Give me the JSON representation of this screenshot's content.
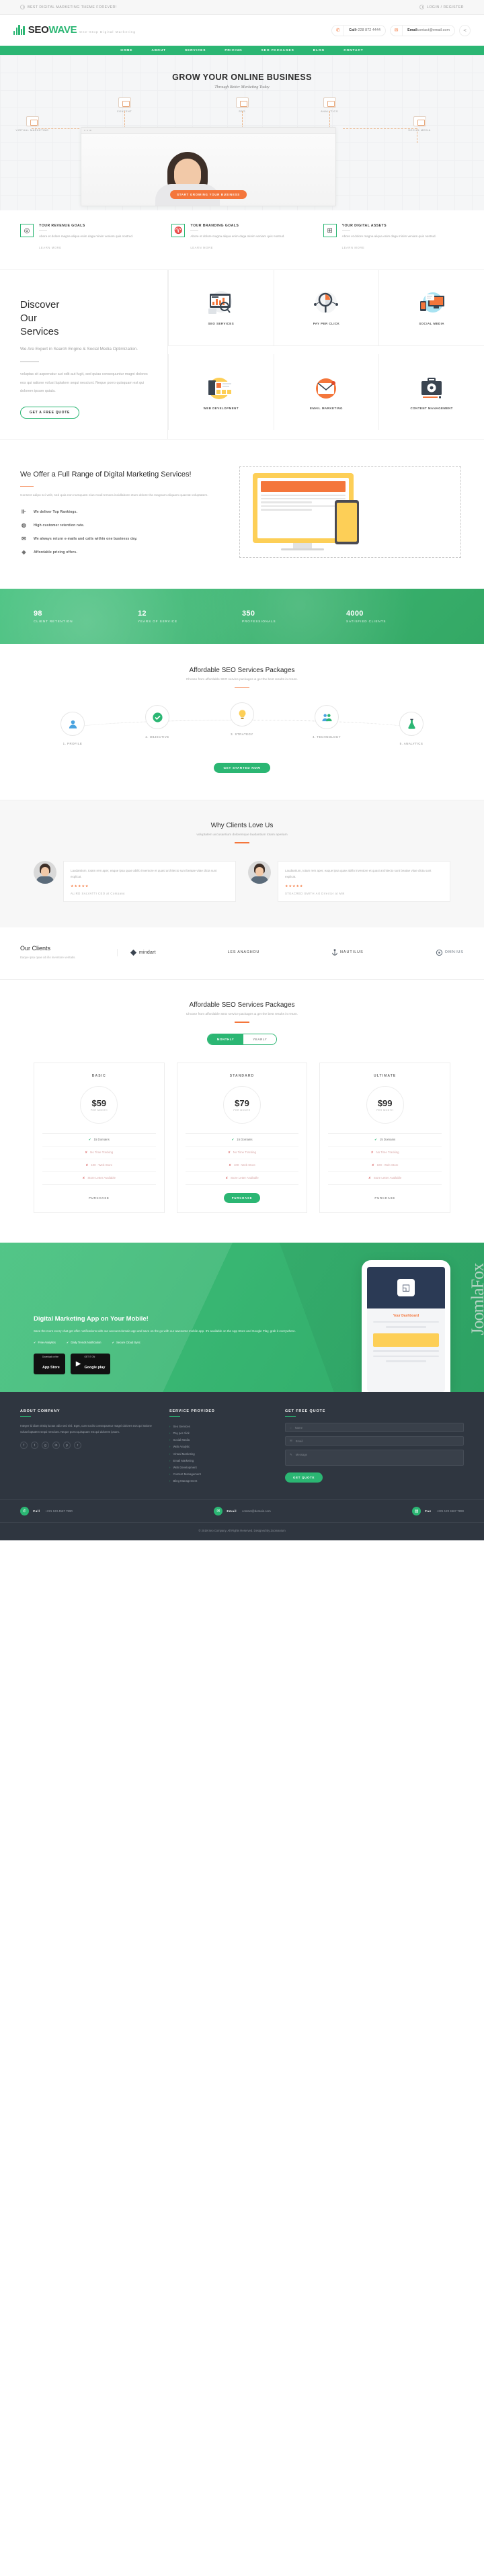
{
  "topbar": {
    "left": "BEST DIGITAL MARKETING THEME FOREVER!",
    "right": "LOGIN / REGISTER",
    "left_icon": "clock-icon",
    "right_icon": "user-icon"
  },
  "header": {
    "brand_a": "SEO",
    "brand_b": "WAVE",
    "tagline": "One-Stop Digital Marketing",
    "phone_label": "Call",
    "phone_value": "+228 872 4444",
    "email_label": "Email",
    "email_value": "contact@email.com",
    "share_icon": "share-icon"
  },
  "nav": {
    "items": [
      {
        "label": "HOME"
      },
      {
        "label": "ABOUT"
      },
      {
        "label": "SERVICES"
      },
      {
        "label": "PRICING"
      },
      {
        "label": "SEO PACKAGES"
      },
      {
        "label": "BLOG"
      },
      {
        "label": "CONTACT"
      }
    ]
  },
  "hero": {
    "title": "GROW YOUR ONLINE BUSINESS",
    "subtitle": "Through Better Marketing Today",
    "cta": "START GROWING YOUR BUSINESS",
    "nodes": [
      {
        "label": "VIRTUAL MARKETING"
      },
      {
        "label": "CONTENT"
      },
      {
        "label": "SEO"
      },
      {
        "label": "ANALYTICS"
      },
      {
        "label": "SOCIAL MEDIA"
      }
    ]
  },
  "features": [
    {
      "icon": "target-icon",
      "title": "YOUR REVENUE GOALS",
      "text": "Abore et dolore magna aliqua enim daga minim veniam quis nostrud.",
      "link": "LEARN MORE"
    },
    {
      "icon": "bulb-icon",
      "title": "YOUR BRANDING GOALS",
      "text": "Abore et dolore magna aliqua enim daga minim veniam quis nostrud.",
      "link": "LEARN MORE"
    },
    {
      "icon": "chart-icon",
      "title": "YOUR DIGITAL ASSETS",
      "text": "Abore et dolore magna aliqua enim daga minim veniam quis nostrud.",
      "link": "LEARN MORE"
    }
  ],
  "services": {
    "heading_line1": "Discover",
    "heading_line2": "Our",
    "heading_line3": "Services",
    "lead": "We Are Expert in Search Engine & Social Media Optimization.",
    "body": "voluptas sit aspernatur aut odit aut fugit, sed quias consequuntur magni dolores eos qui ratione volust luptatem sequi nesciunt. Neque porro quisquam est qui dolorem ipsum quiala.",
    "button": "GET A FREE QUOTE",
    "items": [
      {
        "label": "SEO SERVICES",
        "icon": "seo-dashboard-icon"
      },
      {
        "label": "PAY PER CLICK",
        "icon": "magnifier-pie-icon"
      },
      {
        "label": "SOCIAL MEDIA",
        "icon": "monitor-chat-icon"
      },
      {
        "label": "WEB DEVELOPMENT",
        "icon": "browser-layout-icon"
      },
      {
        "label": "EMAIL MARKETING",
        "icon": "envelope-icon"
      },
      {
        "label": "CONTENT MANAGEMENT",
        "icon": "briefcase-gear-icon"
      }
    ]
  },
  "range": {
    "title": "We Offer a Full Range of Digital Marketing Services!",
    "text": "Consect adipo sci velit, sed quia non numquam eius modi temora incidlabore etum dolore tha magnam aliquam quaerat voluptatem.",
    "points": [
      {
        "icon": "bar-chart-icon",
        "label": "We deliver Top Rankings."
      },
      {
        "icon": "people-icon",
        "label": "High customer retention rate."
      },
      {
        "icon": "mail-icon",
        "label": "We always return e-mails and calls within one business day."
      },
      {
        "icon": "tag-icon",
        "label": "Affordable pricing offers."
      }
    ]
  },
  "counters": [
    {
      "num": "98",
      "label": "CLIENT RETENTION"
    },
    {
      "num": "12",
      "label": "YEARS OF SERVICE"
    },
    {
      "num": "350",
      "label": "PROFESSIONALS"
    },
    {
      "num": "4000",
      "label": "SATISFIED CLIENTS"
    }
  ],
  "packages_steps": {
    "title": "Affordable SEO Services Packages",
    "subtitle": "Choose from affordable SEO service packages & get the best results in return.",
    "steps": [
      {
        "num": "1",
        "label": "1. PROFILE",
        "icon": "user-circle-icon"
      },
      {
        "num": "2",
        "label": "2. OBJECTIVE",
        "icon": "check-target-icon"
      },
      {
        "num": "3",
        "label": "3. STRATEGY",
        "icon": "bulb-idea-icon"
      },
      {
        "num": "4",
        "label": "4. TECHNOLOGY",
        "icon": "group-icon"
      },
      {
        "num": "5",
        "label": "5. ANALYTICS",
        "icon": "flask-icon"
      }
    ],
    "button": "GET STARTED NOW"
  },
  "testimonials": {
    "title": "Why Clients Love Us",
    "subtitle": "voluptatem accusantium doloremque laudantium totam aperiam",
    "items": [
      {
        "text": "Laudantium, totam rem aper, eaque ipsa quae abillo inventore et quasi architecto sunt beatae vitae dicta sunt explicat.",
        "stars": "★★★★★",
        "name": "ALIRD SALVATTI",
        "role": "CEO at Company"
      },
      {
        "text": "Laudantium, totam rem aper, eaque ipsa quae abillo inventore et quasi architecto sunt beatae vitae dicta sunt explicat.",
        "stars": "★★★★★",
        "name": "STEACRED SMITH",
        "role": "Art Director at Mik"
      }
    ]
  },
  "clients": {
    "title": "Our Clients",
    "text": "Eaque ipsa quae ab illo inventore veritatis.",
    "logos": [
      {
        "name": "mindart",
        "sub": ""
      },
      {
        "name": "LES ANAGHOU",
        "sub": ""
      },
      {
        "name": "NAUTILUS",
        "sub": ""
      },
      {
        "name": "OMNIUS",
        "sub": ""
      }
    ]
  },
  "pricing": {
    "title": "Affordable SEO Services Packages",
    "subtitle": "Choose from affordable SEO service packages & get the best results in return.",
    "toggle_on": "MONTHLY",
    "toggle_off": "YEARLY",
    "plans": [
      {
        "name": "BASIC",
        "price": "$59",
        "per": "PER MONTH",
        "features": [
          {
            "label": "15 Domains",
            "ok": true
          },
          {
            "label": "No Time Tracking",
            "ok": false
          },
          {
            "label": "100 - Web Store",
            "ok": false
          },
          {
            "label": "Store Letter Available",
            "ok": false
          }
        ],
        "button": "PURCHASE",
        "featured": false
      },
      {
        "name": "STANDARD",
        "price": "$79",
        "per": "PER MONTH",
        "features": [
          {
            "label": "15 Domains",
            "ok": true
          },
          {
            "label": "No Time Tracking",
            "ok": false
          },
          {
            "label": "100 - Web Store",
            "ok": false
          },
          {
            "label": "Store Letter Available",
            "ok": false
          }
        ],
        "button": "PURCHASE",
        "featured": true
      },
      {
        "name": "ULTIMATE",
        "price": "$99",
        "per": "PER MONTH",
        "features": [
          {
            "label": "15 Domains",
            "ok": true
          },
          {
            "label": "No Time Tracking",
            "ok": false
          },
          {
            "label": "100 - Web Store",
            "ok": false
          },
          {
            "label": "Store Letter Available",
            "ok": false
          }
        ],
        "button": "PURCHASE",
        "featured": false
      }
    ]
  },
  "app": {
    "title": "Digital Marketing App on Your Mobile!",
    "text": "Save the more every chat get offer notifications with our account domain app and save on the go with our awesome mobile app. It's available on the App Store and Google Play, grab it everywhere.",
    "points": [
      {
        "label": "Free Analytics",
        "icon": "check-icon"
      },
      {
        "label": "Daily Trends Notification",
        "icon": "check-icon"
      },
      {
        "label": "Secure Cloud Sync",
        "icon": "check-icon"
      }
    ],
    "store1_small": "Download on the",
    "store1_big": "App Store",
    "store2_small": "GET IT ON",
    "store2_big": "Google play",
    "phone_title": "Your Dashboard"
  },
  "footer": {
    "about": {
      "title": "ABOUT COMPANY",
      "text": "Integer id diam tristiq luctus odio sed nisl. Eget, cum sociis consequuntur magni dolores eos qui ratione volust luptatem sequi nesciunt. Neque porro quisquam est qui dolorem ipsum."
    },
    "social_icons": [
      "facebook-icon",
      "twitter-icon",
      "google-plus-icon",
      "linkedin-icon",
      "pinterest-icon",
      "rss-icon"
    ],
    "links": {
      "title": "SERVICE PROVIDED",
      "items": [
        {
          "label": "Seo Services"
        },
        {
          "label": "Pay per click"
        },
        {
          "label": "Social Media"
        },
        {
          "label": "Web Analytic"
        },
        {
          "label": "Virtual Marketing"
        },
        {
          "label": "Email Marketing"
        },
        {
          "label": "Web Development"
        },
        {
          "label": "Content Management"
        },
        {
          "label": "Bling Management"
        }
      ]
    },
    "quote": {
      "title": "GET FREE QUOTE",
      "name_placeholder": "Name",
      "email_placeholder": "Email",
      "message_placeholder": "Message",
      "button": "GET QUOTE"
    },
    "contacts": [
      {
        "icon": "phone-icon",
        "label": "Call",
        "value": "+221 123 4567 7890"
      },
      {
        "icon": "mail-icon",
        "label": "Email",
        "value": "contact@domain.com"
      },
      {
        "icon": "fax-icon",
        "label": "Fax",
        "value": "+221 123 4567 7890"
      }
    ],
    "copyright": "© 2019 Seo Company. All Rights Reserved. Designed By Zoomanium"
  },
  "watermark": "JoomlaFox",
  "colors": {
    "green": "#2bb673",
    "orange": "#f4763b",
    "dark": "#2f3640",
    "yellow": "#fdcf57"
  }
}
